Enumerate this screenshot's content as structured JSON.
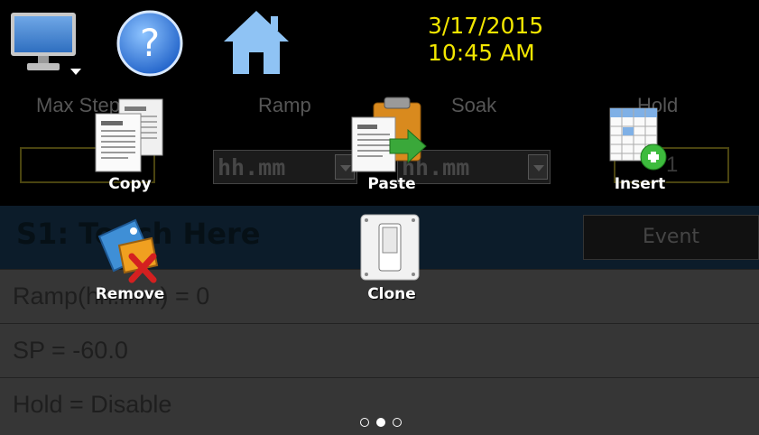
{
  "header": {
    "date": "3/17/2015",
    "time": "10:45 AM",
    "icons": {
      "monitor": "monitor-icon",
      "help": "help-icon",
      "home": "home-icon"
    },
    "date_color": "#f2e600"
  },
  "setup": {
    "labels": {
      "max_steps": "Max Steps",
      "ramp": "Ramp",
      "soak": "Soak",
      "hold": "Hold"
    },
    "ramp_units": "hh.mm",
    "soak_units": "hh.mm",
    "hold_value": "1"
  },
  "step": {
    "title": "S1: Touch Here",
    "event_button": "Event",
    "rows": [
      "Ramp(hh.mm) = 0",
      "SP = -60.0",
      "Hold = Disable"
    ]
  },
  "menu": {
    "copy": "Copy",
    "paste": "Paste",
    "insert": "Insert",
    "remove": "Remove",
    "clone": "Clone"
  },
  "pager": {
    "total": 3,
    "current": 2
  }
}
